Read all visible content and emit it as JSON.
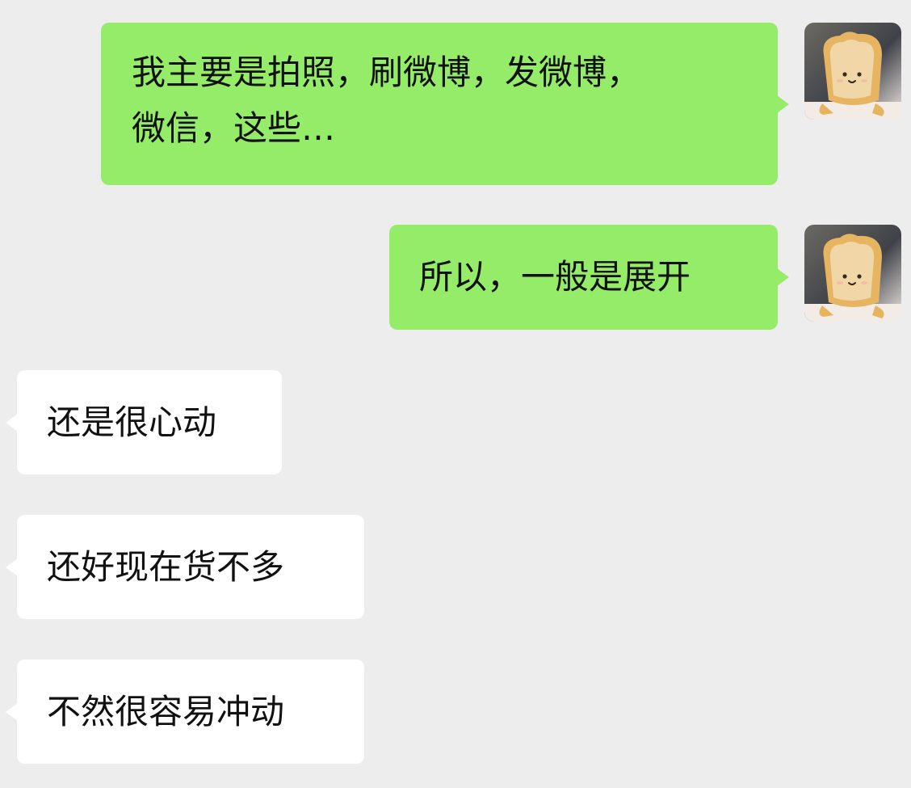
{
  "messages": [
    {
      "direction": "outgoing",
      "text": "我主要是拍照，刷微博，发微博，\n微信，这些…"
    },
    {
      "direction": "outgoing",
      "text": "所以，一般是展开"
    },
    {
      "direction": "incoming",
      "text": "还是很心动"
    },
    {
      "direction": "incoming",
      "text": "还好现在货不多"
    },
    {
      "direction": "incoming",
      "text": "不然很容易冲动"
    }
  ],
  "avatar": {
    "icon": "toast-bread-plush-avatar"
  },
  "colors": {
    "background": "#ededed",
    "outgoing_bubble": "#95ec69",
    "incoming_bubble": "#ffffff",
    "text": "#111111"
  }
}
